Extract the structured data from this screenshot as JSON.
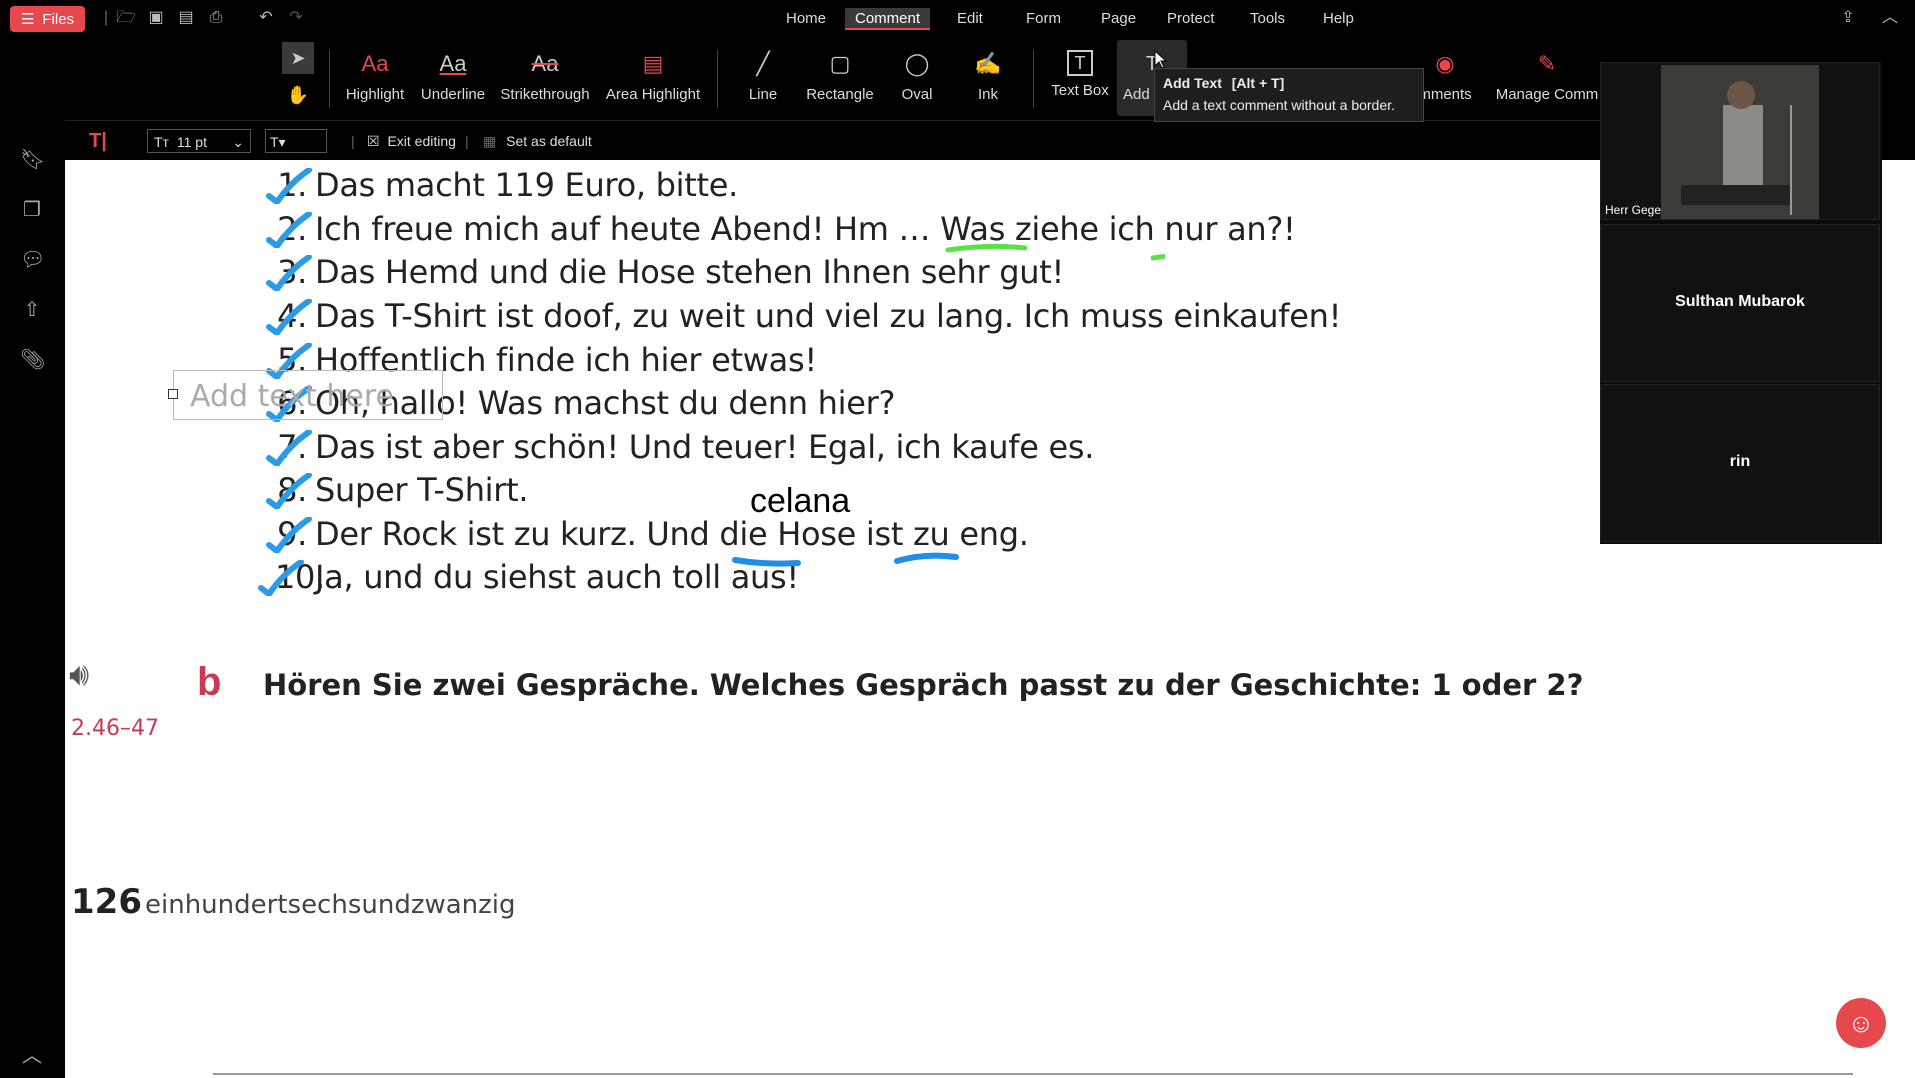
{
  "topbar": {
    "files_label": "Files",
    "menu": [
      "Home",
      "Comment",
      "Edit",
      "Form",
      "Page",
      "Protect",
      "Tools",
      "Help"
    ],
    "active_menu": "Comment"
  },
  "ribbon": {
    "tools": [
      {
        "label": "Highlight",
        "icon": "Aa"
      },
      {
        "label": "Underline",
        "icon": "Aa"
      },
      {
        "label": "Strikethrough",
        "icon": "Aa"
      },
      {
        "label": "Area Highlight",
        "icon": "▤"
      },
      {
        "label": "Line",
        "icon": "╱"
      },
      {
        "label": "Rectangle",
        "icon": "▢"
      },
      {
        "label": "Oval",
        "icon": "◯"
      },
      {
        "label": "Ink",
        "icon": "✍"
      },
      {
        "label": "Text Box",
        "icon": "T"
      },
      {
        "label": "Add",
        "icon": "T"
      },
      {
        "label": "mments",
        "icon": "◉"
      },
      {
        "label": "Manage Comm",
        "icon": "✎"
      }
    ]
  },
  "formatbar": {
    "font_size": "11 pt",
    "exit_editing": "Exit editing",
    "set_default": "Set as default"
  },
  "tooltip": {
    "title": "Add Text",
    "shortcut": "[Alt + T]",
    "description": "Add a text comment without a border."
  },
  "document": {
    "lines": [
      {
        "num": "1.",
        "text": "Das macht 119 Euro, bitte."
      },
      {
        "num": "2.",
        "text": "Ich freue mich auf heute Abend! Hm … Was ziehe ich nur an?!"
      },
      {
        "num": "3.",
        "text": "Das Hemd und die Hose stehen Ihnen sehr gut!"
      },
      {
        "num": "4.",
        "text": "Das T-Shirt ist doof, zu weit und viel zu lang. Ich muss einkaufen!"
      },
      {
        "num": "5.",
        "text": "Hoffentlich finde ich hier etwas!"
      },
      {
        "num": "6.",
        "text": "Oh, hallo! Was machst du denn hier?"
      },
      {
        "num": "7.",
        "text": "Das ist aber schön! Und teuer! Egal, ich kaufe es."
      },
      {
        "num": "8.",
        "text": "Super T-Shirt."
      },
      {
        "num": "9.",
        "text": "Der Rock ist zu kurz. Und die Hose ist zu eng."
      },
      {
        "num": "10.",
        "text": "Ja, und du siehst auch toll aus!"
      }
    ],
    "add_text_placeholder": "Add text here",
    "annotation": "celana",
    "track": "2.46–47",
    "section_letter": "b",
    "section_text": "Hören Sie zwei Gespräche. Welches Gespräch passt zu der Geschichte: 1 oder 2?",
    "page_number": "126",
    "page_word": "einhundertsechsundzwanzig"
  },
  "video": {
    "tiles": [
      {
        "name": "Herr Gege",
        "has_video": true
      },
      {
        "name": "Sulthan Mubarok",
        "has_video": false
      },
      {
        "name": "rin",
        "has_video": false
      }
    ]
  },
  "colors": {
    "accent": "#e5484d",
    "check": "#2b9be8",
    "underline_green": "#5be04a",
    "underline_blue": "#1e8fe6"
  }
}
